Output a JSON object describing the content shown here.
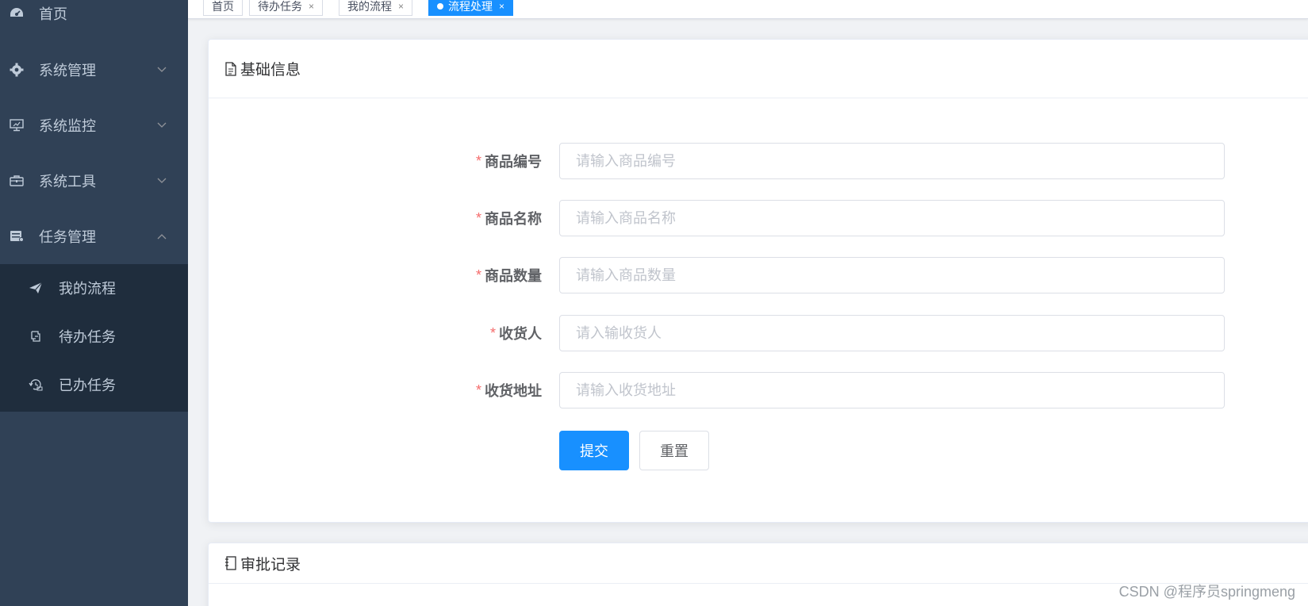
{
  "sidebar": {
    "items": [
      {
        "label": "首页",
        "icon": "dashboard-icon"
      },
      {
        "label": "系统管理",
        "icon": "gear-icon"
      },
      {
        "label": "系统监控",
        "icon": "monitor-icon"
      },
      {
        "label": "系统工具",
        "icon": "toolbox-icon"
      },
      {
        "label": "任务管理",
        "icon": "server-icon"
      }
    ],
    "submenu": [
      {
        "label": "我的流程",
        "icon": "paper-plane-icon"
      },
      {
        "label": "待办任务",
        "icon": "clipboard-icon"
      },
      {
        "label": "已办任务",
        "icon": "history-icon"
      }
    ]
  },
  "tags": [
    {
      "label": "首页",
      "closable": false,
      "active": false
    },
    {
      "label": "待办任务",
      "closable": true,
      "active": false
    },
    {
      "label": "我的流程",
      "closable": true,
      "active": false
    },
    {
      "label": "流程处理",
      "closable": true,
      "active": true
    }
  ],
  "tag_close_glyph": "×",
  "basic_info": {
    "title": "基础信息",
    "required_mark": "*",
    "fields": [
      {
        "label": "商品编号",
        "placeholder": "请输入商品编号",
        "value": ""
      },
      {
        "label": "商品名称",
        "placeholder": "请输入商品名称",
        "value": ""
      },
      {
        "label": "商品数量",
        "placeholder": "请输入商品数量",
        "value": ""
      },
      {
        "label": "收货人",
        "placeholder": "请入输收货人",
        "value": ""
      },
      {
        "label": "收货地址",
        "placeholder": "请输入收货地址",
        "value": ""
      }
    ],
    "submit_label": "提交",
    "reset_label": "重置"
  },
  "approval": {
    "title": "审批记录"
  },
  "watermark": "CSDN @程序员springmeng",
  "colors": {
    "sidebar_bg": "#304156",
    "submenu_bg": "#1f2d3d",
    "primary": "#1890ff",
    "required": "#f56c6c"
  }
}
